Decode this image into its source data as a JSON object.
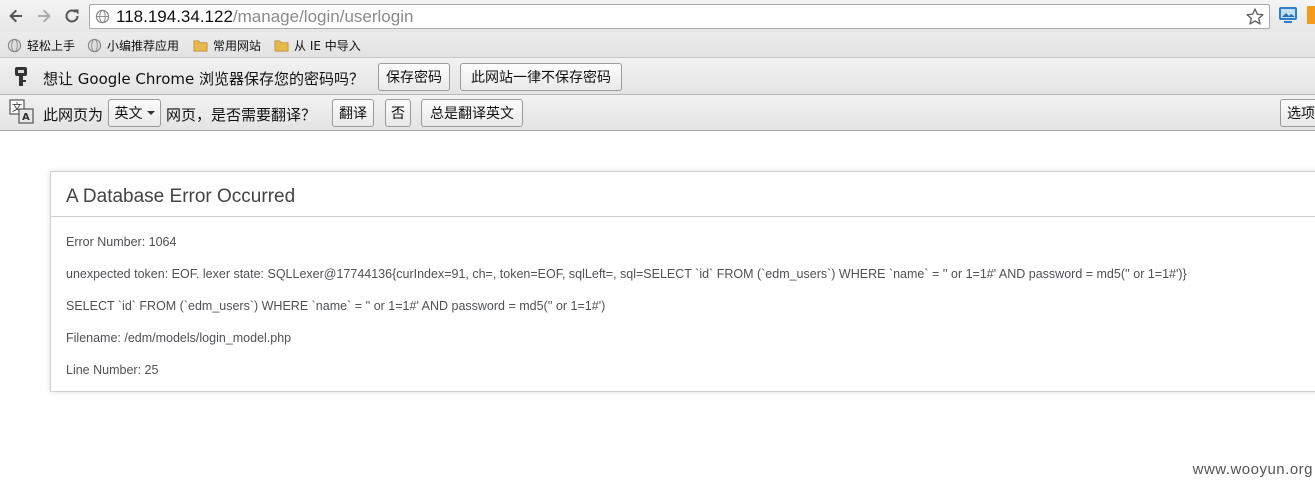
{
  "browser": {
    "url_host": "118.194.34.122",
    "url_path": "/manage/login/userlogin"
  },
  "bookmarks": [
    {
      "label": "轻松上手",
      "icon": "globe-icon"
    },
    {
      "label": "小编推荐应用",
      "icon": "globe-icon"
    },
    {
      "label": "常用网站",
      "icon": "folder-icon"
    },
    {
      "label": "从 IE 中导入",
      "icon": "folder-icon"
    }
  ],
  "password_bar": {
    "message": "想让 Google Chrome 浏览器保存您的密码吗？",
    "save_label": "保存密码",
    "never_label": "此网站一律不保存密码"
  },
  "translate_bar": {
    "prefix": "此网页为",
    "language": "英文",
    "suffix": "网页，是否需要翻译？",
    "translate_label": "翻译",
    "no_label": "否",
    "always_label": "总是翻译英文",
    "options_label": "选项"
  },
  "error": {
    "title": "A Database Error Occurred",
    "lines": [
      "Error Number: 1064",
      "unexpected token: EOF. lexer state: SQLLexer@17744136{curIndex=91, ch=, token=EOF, sqlLeft=, sql=SELECT `id` FROM (`edm_users`) WHERE `name` = '' or 1=1#' AND password = md5('' or 1=1#')}",
      "SELECT `id` FROM (`edm_users`) WHERE `name` = '' or 1=1#' AND password = md5('' or 1=1#')",
      "Filename: /edm/models/login_model.php",
      "Line Number: 25"
    ]
  },
  "watermark": "www.wooyun.org",
  "colors": {
    "accent_orange": "#f39a1a",
    "folder": "#e8b84a",
    "text_gray": "#4f5155"
  }
}
